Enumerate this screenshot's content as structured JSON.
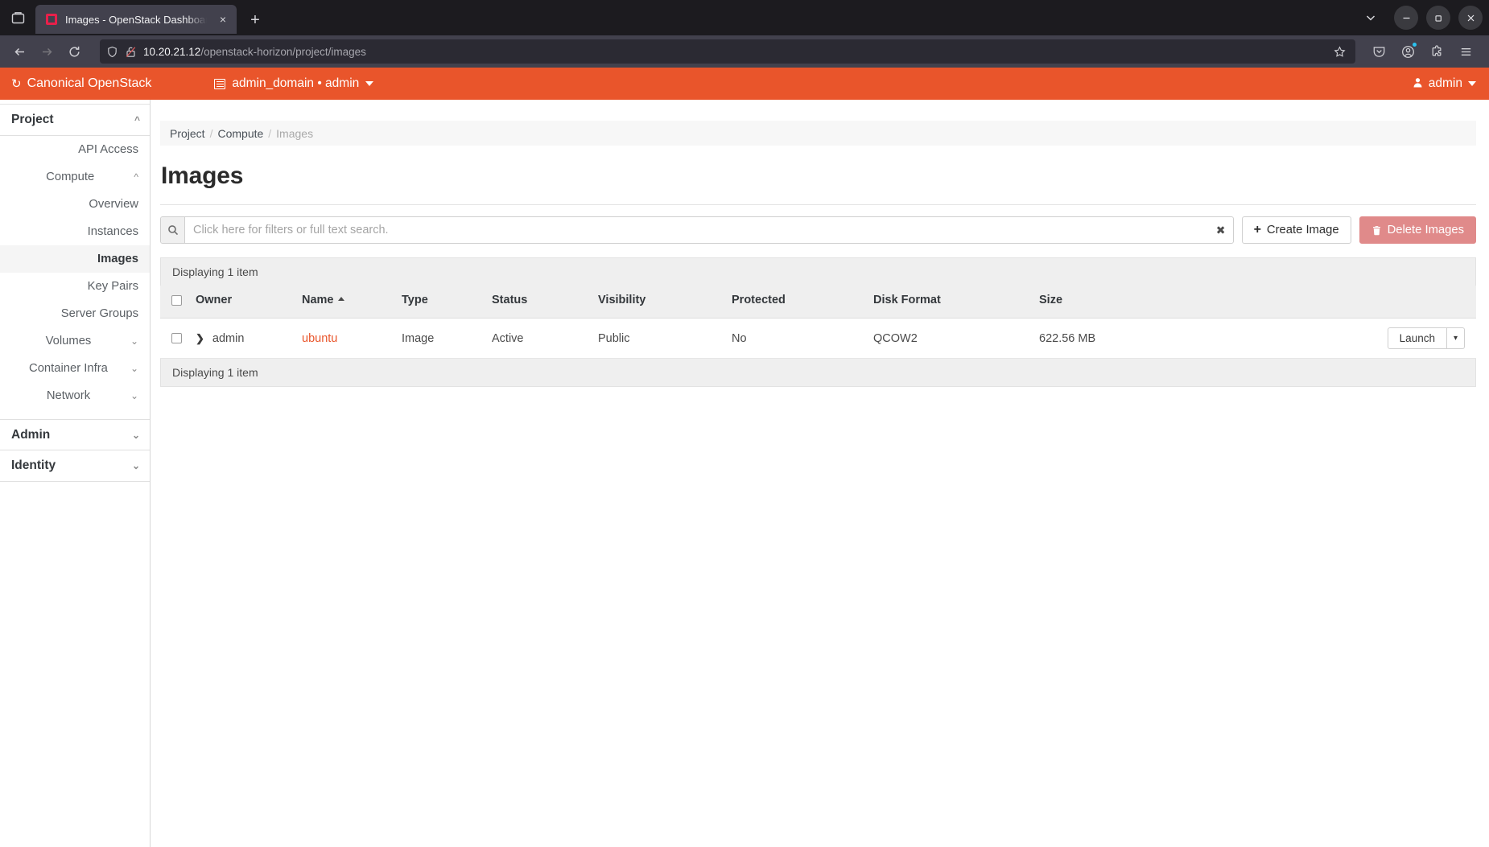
{
  "browser": {
    "tab": {
      "title": "Images - OpenStack Dashboard",
      "favicon_name": "openstack-favicon",
      "close_label": "×"
    },
    "new_tab_label": "+",
    "tab_list_icon": "tab-list-icon",
    "chevron_down_label": "⌄",
    "window_controls": {
      "minimize": "—",
      "maximize": "❐",
      "close": "✕"
    },
    "nav": {
      "back": "←",
      "forward": "→",
      "reload": "⟳"
    },
    "url": {
      "host": "10.20.21.12",
      "path": "/openstack-horizon/project/images",
      "shield_icon": "shield-icon",
      "lock_broken_icon": "lock-broken-icon",
      "bookmark_icon": "star-icon"
    },
    "toolbar_right": {
      "pocket": "pocket-icon",
      "account": "account-icon",
      "extensions": "extensions-icon",
      "menu": "hamburger-menu-icon"
    }
  },
  "header": {
    "brand": "Canonical OpenStack",
    "brand_logo_glyph": "↻",
    "context": "admin_domain • admin",
    "user": "admin",
    "accent_color": "#e9552b"
  },
  "sidebar": {
    "groups": [
      {
        "label": "Project",
        "expanded": true,
        "items": [
          {
            "label": "API Access",
            "active": false,
            "type": "link"
          },
          {
            "label": "Compute",
            "active": false,
            "type": "group",
            "expanded": true
          },
          {
            "label": "Overview",
            "active": false,
            "type": "link"
          },
          {
            "label": "Instances",
            "active": false,
            "type": "link"
          },
          {
            "label": "Images",
            "active": true,
            "type": "link"
          },
          {
            "label": "Key Pairs",
            "active": false,
            "type": "link"
          },
          {
            "label": "Server Groups",
            "active": false,
            "type": "link"
          },
          {
            "label": "Volumes",
            "active": false,
            "type": "group",
            "expanded": false
          },
          {
            "label": "Container Infra",
            "active": false,
            "type": "group",
            "expanded": false
          },
          {
            "label": "Network",
            "active": false,
            "type": "group",
            "expanded": false
          }
        ]
      },
      {
        "label": "Admin",
        "expanded": false,
        "items": []
      },
      {
        "label": "Identity",
        "expanded": false,
        "items": []
      }
    ]
  },
  "breadcrumb": {
    "items": [
      "Project",
      "Compute",
      "Images"
    ],
    "separator": "/"
  },
  "page": {
    "title": "Images"
  },
  "search": {
    "placeholder": "Click here for filters or full text search.",
    "value": "",
    "clear_label": "✖",
    "icon": "search-icon"
  },
  "actions": {
    "create": {
      "label": "Create Image",
      "icon": "plus-icon"
    },
    "delete": {
      "label": "Delete Images",
      "icon": "trash-icon",
      "color": "#e08a8a"
    }
  },
  "table": {
    "count_top": "Displaying 1 item",
    "count_bottom": "Displaying 1 item",
    "sort_column": "Name",
    "sort_direction": "asc",
    "columns": [
      "Owner",
      "Name",
      "Type",
      "Status",
      "Visibility",
      "Protected",
      "Disk Format",
      "Size"
    ],
    "rows": [
      {
        "selected": false,
        "owner": "admin",
        "name": "ubuntu",
        "type": "Image",
        "status": "Active",
        "visibility": "Public",
        "protected": "No",
        "disk_format": "QCOW2",
        "size": "622.56 MB",
        "action_label": "Launch",
        "action_caret": "▾"
      }
    ]
  }
}
